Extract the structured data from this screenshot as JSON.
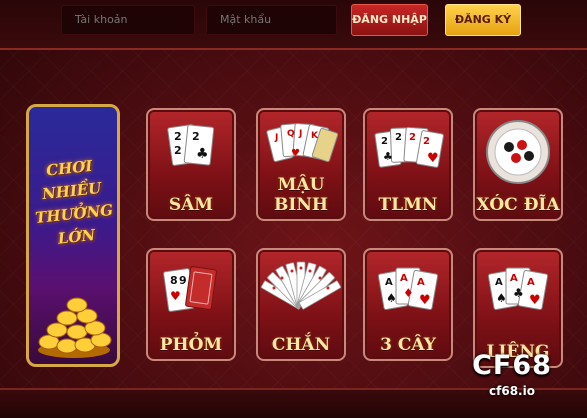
{
  "login": {
    "username_placeholder": "Tài khoản",
    "password_placeholder": "Mật khẩu",
    "login_label": "ĐĂNG NHẬP",
    "register_label": "ĐĂNG KÝ"
  },
  "promo": {
    "line1": "CHƠI NHIỀU",
    "line2": "THƯỞNG LỚN"
  },
  "games": [
    {
      "label": "SÂM"
    },
    {
      "label": "MẬU BINH"
    },
    {
      "label": "TLMN"
    },
    {
      "label": "XÓC ĐĨA"
    },
    {
      "label": "PHỎM"
    },
    {
      "label": "CHẮN"
    },
    {
      "label": "3 CÂY"
    },
    {
      "label": "LIÊNG"
    }
  ],
  "brand": {
    "name": "CF68",
    "url": "cf68.io"
  },
  "colors": {
    "background": "#4a0c10",
    "tile": "#9a1c20",
    "tile_border": "#c9897a",
    "label": "#ffe7a6",
    "login_button": "#c72724",
    "register_button": "#ffd24a",
    "promo_border": "#d7a944"
  },
  "icons": [
    "cards-icon",
    "rose-card-icon",
    "xoc-dia-plate-icon",
    "coins-icon"
  ]
}
